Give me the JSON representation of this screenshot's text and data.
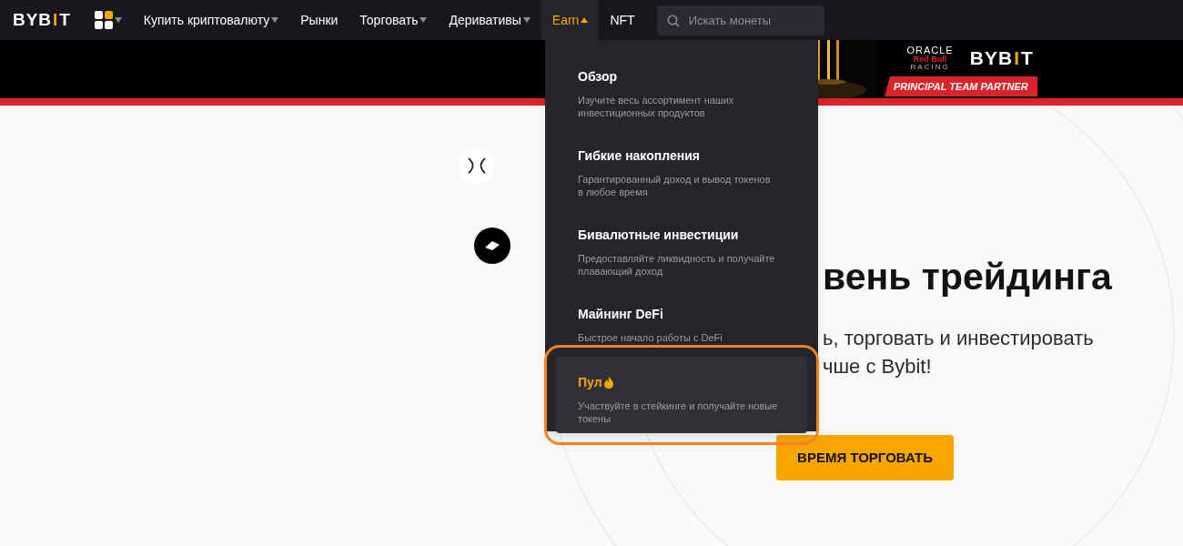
{
  "logo": {
    "before": "BYB",
    "accent": "I",
    "after": "T"
  },
  "nav": [
    {
      "label": "Купить криптовалюту",
      "caret": true,
      "open": false
    },
    {
      "label": "Рынки",
      "caret": false,
      "open": false
    },
    {
      "label": "Торговать",
      "caret": true,
      "open": false
    },
    {
      "label": "Деривативы",
      "caret": true,
      "open": false
    },
    {
      "label": "Earn",
      "caret": true,
      "open": true
    },
    {
      "label": "NFT",
      "caret": false,
      "open": false
    }
  ],
  "search": {
    "placeholder": "Искать монеты"
  },
  "banner": {
    "oracle": "ORACLE",
    "redbull": "Red Bull",
    "racing": "RACING",
    "partner_logo": {
      "before": "BYB",
      "accent": "I",
      "after": "T"
    },
    "tagline": "PRINCIPAL TEAM PARTNER"
  },
  "earn_menu": [
    {
      "title": "Обзор",
      "description": "Изучите весь ассортимент наших инвестиционных продуктов",
      "selected": false,
      "hot": false
    },
    {
      "title": "Гибкие накопления",
      "description": "Гарантированный доход и вывод токенов в любое время",
      "selected": false,
      "hot": false
    },
    {
      "title": "Бивалютные инвестиции",
      "description": "Предоставляйте ликвидность и получайте плавающий доход",
      "selected": false,
      "hot": false
    },
    {
      "title": "Майнинг DeFi",
      "description": "Быстрое начало работы с DeFi",
      "selected": false,
      "hot": false
    },
    {
      "title": "Пул",
      "description": "Участвуйте в стейкинге и получайте новые токены",
      "selected": true,
      "hot": true
    }
  ],
  "hero": {
    "heading": "вень трейдинга",
    "subtitle_lines": [
      "ь, торговать и инвестировать",
      "чше с Bybit!"
    ],
    "cta": "ВРЕМЯ ТОРГОВАТЬ"
  }
}
